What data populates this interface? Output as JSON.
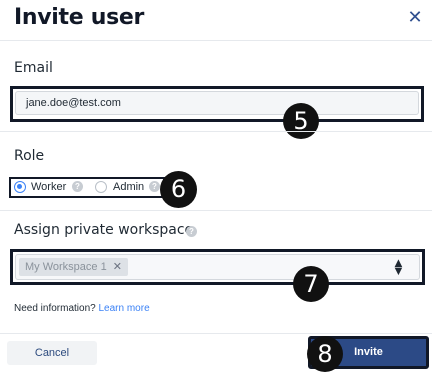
{
  "dialog": {
    "title": "Invite user",
    "close_icon": "close-icon"
  },
  "email": {
    "label": "Email",
    "value": "jane.doe@test.com"
  },
  "role": {
    "label": "Role",
    "options": [
      {
        "label": "Worker",
        "selected": true
      },
      {
        "label": "Admin",
        "selected": false
      }
    ]
  },
  "workspace": {
    "label": "Assign private workspace",
    "chips": [
      {
        "label": "My Workspace 1"
      }
    ],
    "remove_icon": "close-icon",
    "dropdown_icon": "sort-arrows-icon"
  },
  "info": {
    "text": "Need information?",
    "link": "Learn more"
  },
  "footer": {
    "cancel_label": "Cancel",
    "invite_label": "Invite"
  },
  "callouts": {
    "email": "5",
    "role": "6",
    "workspace": "7",
    "invite": "8"
  },
  "colors": {
    "primary": "#2c4a86",
    "accent": "#3b82f6",
    "callout": "#111111"
  }
}
